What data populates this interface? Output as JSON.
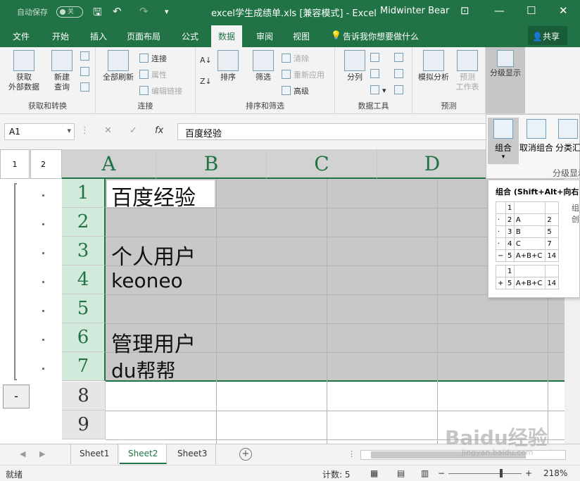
{
  "titlebar": {
    "autosave": "自动保存",
    "autosave_state": "关",
    "title": "excel学生成绩单.xls  [兼容模式]  -  Excel",
    "user": "Midwinter Bear"
  },
  "tabs": [
    {
      "label": "文件"
    },
    {
      "label": "开始"
    },
    {
      "label": "插入"
    },
    {
      "label": "页面布局"
    },
    {
      "label": "公式"
    },
    {
      "label": "数据",
      "active": true
    },
    {
      "label": "审阅"
    },
    {
      "label": "视图"
    },
    {
      "label": "告诉我你想要做什么"
    }
  ],
  "share": "共享",
  "ribbon": {
    "get_external": "获取\n外部数据",
    "new_query": "新建\n查询",
    "group_get_transform": "获取和转换",
    "refresh_all": "全部刷新",
    "connections": "连接",
    "properties": "属性",
    "edit_links": "编辑链接",
    "group_connections": "连接",
    "sort": "排序",
    "filter": "筛选",
    "clear": "清除",
    "reapply": "重新应用",
    "advanced": "高级",
    "group_sort_filter": "排序和筛选",
    "text_to_columns": "分列",
    "group_data_tools": "数据工具",
    "what_if": "模拟分析",
    "forecast_sheet": "预测\n工作表",
    "group_forecast": "预测",
    "outline": "分级显示"
  },
  "formula_bar": {
    "namebox": "A1",
    "cancel": "✕",
    "enter": "✓",
    "fx": "fx",
    "content": "百度经验"
  },
  "outline_levels": [
    "1",
    "2"
  ],
  "outline_collapse": "-",
  "columns": [
    "A",
    "B",
    "C",
    "D"
  ],
  "rows": [
    "1",
    "2",
    "3",
    "4",
    "5",
    "6",
    "7",
    "8",
    "9"
  ],
  "cells": {
    "A1": "百度经验",
    "A3": "个人用户",
    "A4": "keoneo",
    "A6": "管理用户",
    "A7": "du帮帮"
  },
  "outline_dropdown": {
    "group": "组合",
    "ungroup": "取消组合",
    "subtotal": "分类汇",
    "label": "分级显示"
  },
  "tooltip": {
    "title": "组合 (Shift+Alt+向右",
    "table1": [
      [
        "",
        "1",
        "",
        ""
      ],
      [
        "·",
        "2",
        "A",
        "2"
      ],
      [
        "·",
        "3",
        "B",
        "5"
      ],
      [
        "·",
        "4",
        "C",
        "7"
      ],
      [
        "−",
        "5",
        "A+B+C",
        "14"
      ]
    ],
    "table2": [
      [
        "",
        "1",
        "",
        ""
      ],
      [
        "+",
        "5",
        "A+B+C",
        "14"
      ]
    ],
    "desc1": "组",
    "desc2": "创"
  },
  "sheets": [
    {
      "name": "Sheet1"
    },
    {
      "name": "Sheet2",
      "active": true
    },
    {
      "name": "Sheet3"
    }
  ],
  "status": {
    "ready": "就绪",
    "count": "计数: 5",
    "zoom": "218%"
  },
  "watermark": {
    "brand": "Baidu经验",
    "url": "jingyan.baidu.com"
  },
  "colors": {
    "accent": "#217346",
    "selection": "#c8c8c8"
  }
}
